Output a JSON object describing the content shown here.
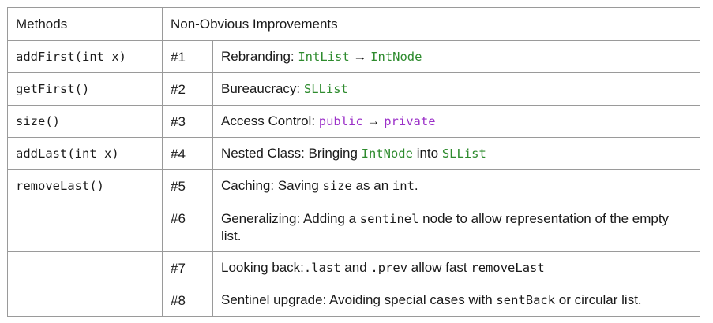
{
  "headers": {
    "methods": "Methods",
    "improvements": "Non-Obvious Improvements"
  },
  "colors": {
    "class_name": "#2e8b2e",
    "keyword": "#9b30c8",
    "border": "#9a9a9a"
  },
  "rows": [
    {
      "method": "addFirst(int x)",
      "num": "#1",
      "parts": [
        {
          "text": "Rebranding: ",
          "style": "plain"
        },
        {
          "text": "IntList",
          "style": "code-green"
        },
        {
          "text": " → ",
          "style": "plain"
        },
        {
          "text": "IntNode",
          "style": "code-green"
        }
      ]
    },
    {
      "method": "getFirst()",
      "num": "#2",
      "parts": [
        {
          "text": "Bureaucracy: ",
          "style": "plain"
        },
        {
          "text": "SLList",
          "style": "code-green"
        }
      ]
    },
    {
      "method": "size()",
      "num": "#3",
      "parts": [
        {
          "text": "Access Control: ",
          "style": "plain"
        },
        {
          "text": "public",
          "style": "code-purple"
        },
        {
          "text": " → ",
          "style": "plain"
        },
        {
          "text": "private",
          "style": "code-purple"
        }
      ]
    },
    {
      "method": "addLast(int x)",
      "num": "#4",
      "parts": [
        {
          "text": "Nested Class: Bringing ",
          "style": "plain"
        },
        {
          "text": "IntNode",
          "style": "code-green"
        },
        {
          "text": " into ",
          "style": "plain"
        },
        {
          "text": "SLList",
          "style": "code-green"
        }
      ]
    },
    {
      "method": "removeLast()",
      "num": "#5",
      "parts": [
        {
          "text": "Caching: Saving ",
          "style": "plain"
        },
        {
          "text": "size",
          "style": "code"
        },
        {
          "text": " as an ",
          "style": "plain"
        },
        {
          "text": "int",
          "style": "code"
        },
        {
          "text": ".",
          "style": "plain"
        }
      ]
    },
    {
      "method": "",
      "num": "#6",
      "parts": [
        {
          "text": "Generalizing: Adding a ",
          "style": "plain"
        },
        {
          "text": "sentinel",
          "style": "code"
        },
        {
          "text": " node to allow representation of the empty list.",
          "style": "plain"
        }
      ]
    },
    {
      "method": "",
      "num": "#7",
      "parts": [
        {
          "text": "Looking back:",
          "style": "plain"
        },
        {
          "text": ".last",
          "style": "code"
        },
        {
          "text": " and ",
          "style": "plain"
        },
        {
          "text": ".prev",
          "style": "code"
        },
        {
          "text": " allow fast ",
          "style": "plain"
        },
        {
          "text": "removeLast",
          "style": "code"
        }
      ]
    },
    {
      "method": "",
      "num": "#8",
      "parts": [
        {
          "text": "Sentinel upgrade: Avoiding special cases with ",
          "style": "plain"
        },
        {
          "text": "sentBack",
          "style": "code"
        },
        {
          "text": " or circular list.",
          "style": "plain"
        }
      ]
    }
  ]
}
